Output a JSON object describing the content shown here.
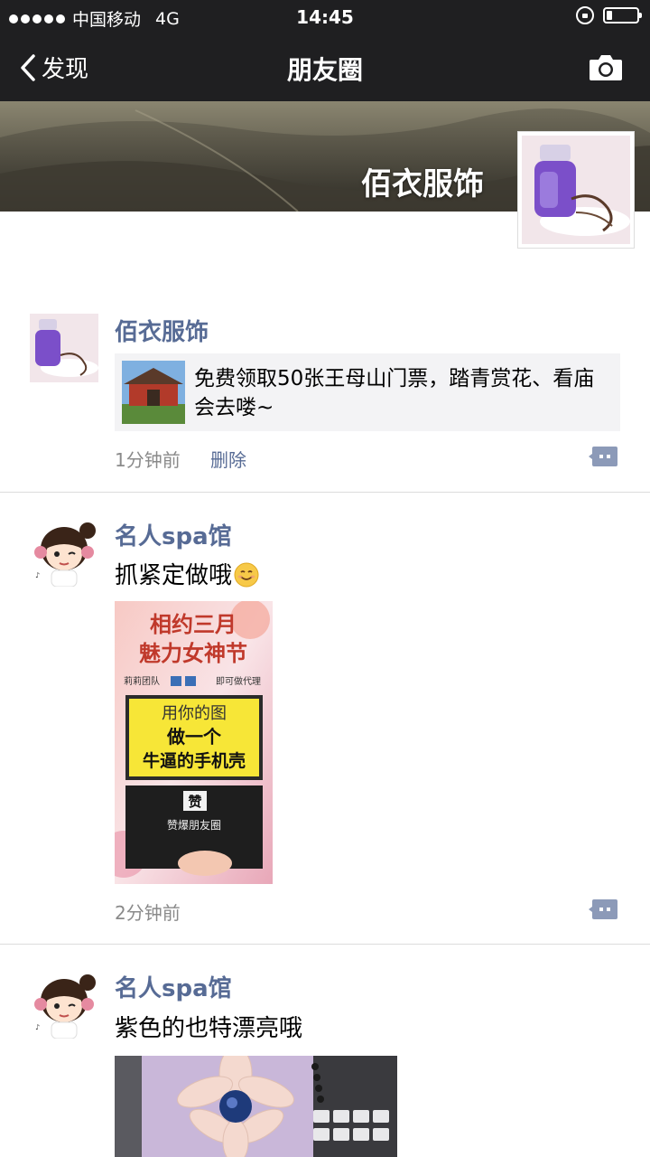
{
  "status_bar": {
    "carrier": "中国移动",
    "network": "4G",
    "time": "14:45",
    "battery_level": 0.2
  },
  "nav": {
    "back_label": "发现",
    "title": "朋友圈"
  },
  "cover": {
    "name": "佰衣服饰"
  },
  "posts": [
    {
      "name": "佰衣服饰",
      "link_title": "免费领取50张王母山门票，踏青赏花、看庙会去喽~",
      "time": "1分钟前",
      "delete_label": "删除"
    },
    {
      "name": "名人spa馆",
      "text": "抓紧定做哦",
      "emoji": "smile-emoji",
      "time": "2分钟前",
      "poster": {
        "line1": "相约三月",
        "line2": "魅力女神节",
        "sub_left": "莉莉团队",
        "sub_right": "即可做代理",
        "box_top": "用你的图",
        "box_line1": "做一个",
        "box_line2": "牛逼的手机壳",
        "like_badge": "赞",
        "bottom_text": "赞爆朋友圈"
      }
    },
    {
      "name": "名人spa馆",
      "text": "紫色的也特漂亮哦"
    }
  ],
  "colors": {
    "header_bg": "#1f1f21",
    "link_blue": "#576b95",
    "time_gray": "#8a8a8a",
    "card_bg": "#f3f3f5"
  }
}
